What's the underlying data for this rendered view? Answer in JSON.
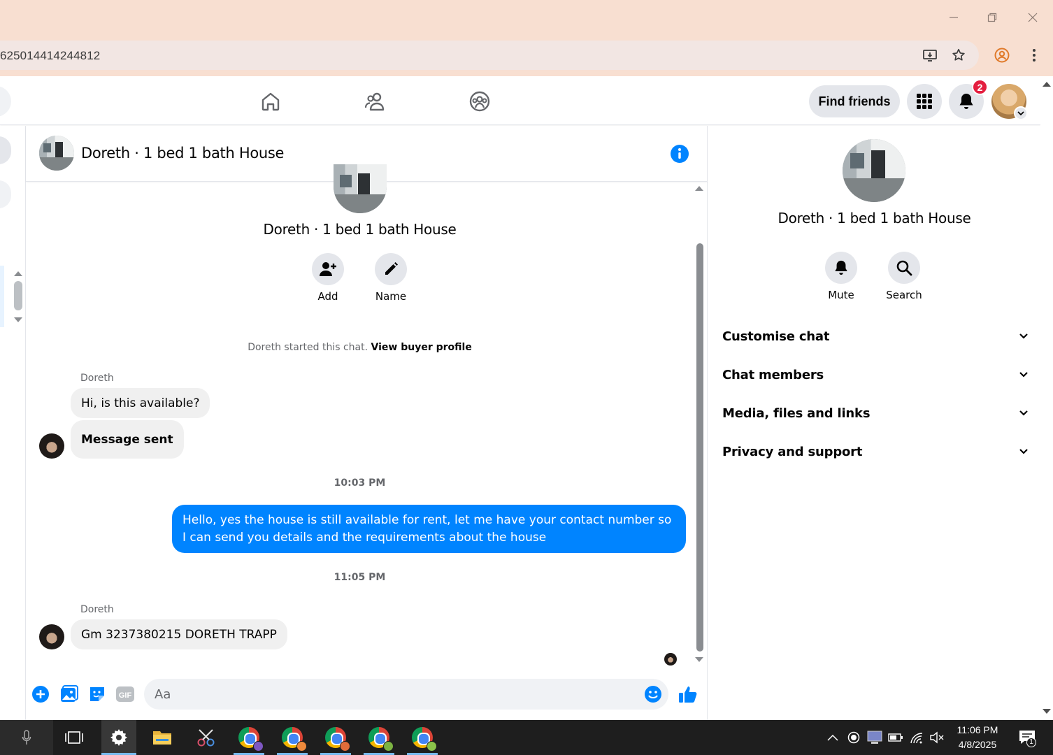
{
  "browser": {
    "url": "625014414244812",
    "window_controls": [
      "minimize-icon",
      "restore-icon",
      "close-icon"
    ]
  },
  "header": {
    "find_friends_label": "Find friends",
    "notification_count": "2",
    "nav_icons": [
      "home-icon",
      "friends-icon",
      "groups-icon"
    ]
  },
  "chat": {
    "title": "Doreth · 1 bed 1 bath House",
    "center_name": "Doreth · 1 bed 1 bath House",
    "actions": [
      {
        "label": "Add",
        "icon": "add-person-icon"
      },
      {
        "label": "Name",
        "icon": "pencil-icon"
      }
    ],
    "started_text": "Doreth started this chat.",
    "buyer_profile_link": "View buyer profile",
    "messages": [
      {
        "sender": "Doreth",
        "text": "Hi, is this available?"
      },
      {
        "text": "Message sent"
      },
      {
        "time": "10:03 PM"
      },
      {
        "outgoing": true,
        "text": "Hello, yes the house is still available for rent, let me have your contact number so I can send you details and the requirements about the house"
      },
      {
        "time": "11:05 PM"
      },
      {
        "sender": "Doreth",
        "text": "Gm 3237380215 DORETH  TRAPP"
      }
    ],
    "composer_placeholder": "Aa",
    "composer_icons": [
      "plus-icon",
      "photo-icon",
      "sticker-icon",
      "gif-icon",
      "emoji-icon",
      "thumbs-up-icon"
    ],
    "gif_label": "GIF"
  },
  "details": {
    "name": "Doreth · 1 bed 1 bath House",
    "buttons": [
      {
        "label": "Mute",
        "icon": "bell-icon"
      },
      {
        "label": "Search",
        "icon": "search-icon"
      }
    ],
    "sections": [
      "Customise chat",
      "Chat members",
      "Media, files and links",
      "Privacy and support"
    ]
  },
  "taskbar": {
    "time": "11:06 PM",
    "date": "4/8/2025",
    "notification_count": "1"
  },
  "colors": {
    "messenger_blue": "#0084ff",
    "badge_red": "#e41e3f",
    "browser_frame": "#f8dfd1",
    "taskbar": "#1e1e1e"
  }
}
